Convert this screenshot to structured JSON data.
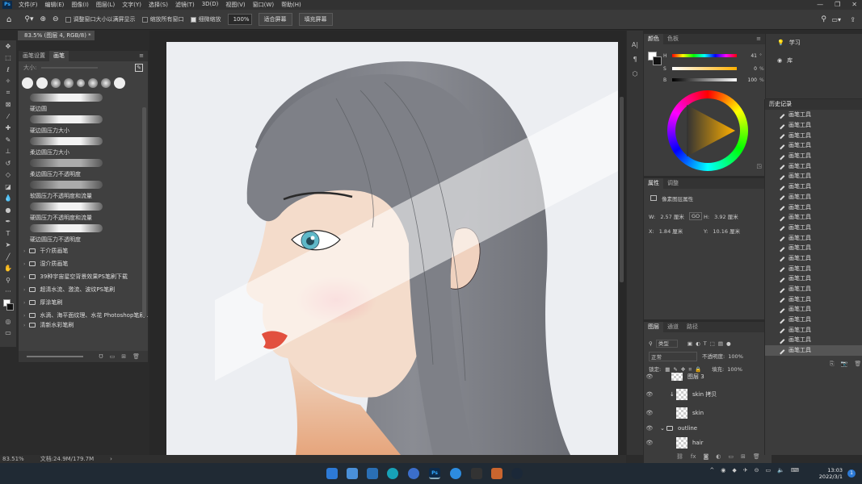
{
  "menu": {
    "app_logo": "Ps",
    "items": [
      "文件(F)",
      "编辑(E)",
      "图像(I)",
      "图层(L)",
      "文字(Y)",
      "选择(S)",
      "滤镜(T)",
      "3D(D)",
      "视图(V)",
      "窗口(W)",
      "帮助(H)"
    ]
  },
  "options": {
    "resize_windows_label": "调整窗口大小以满屏显示",
    "zoom_all_label": "缩放所有窗口",
    "scrubby_zoom_label": "细微缩放",
    "zoom_value": "100%",
    "fit_screen_label": "适合屏幕",
    "fill_screen_label": "填充屏幕"
  },
  "document": {
    "tab_title": "83.5% (图层 4, RGB/8) *",
    "close": "×"
  },
  "brush_panel": {
    "tabs": [
      "画笔设置",
      "画笔"
    ],
    "size_label": "大小:",
    "brushes": [
      "硬边圆",
      "硬边圆压力大小",
      "柔边圆压力大小",
      "柔边圆压力不透明度",
      "软圆压力不透明度和流量",
      "硬圆压力不透明度和流量",
      "硬边圆压力不透明度"
    ],
    "folders": [
      "干介质画笔",
      "湿介质画笔",
      "39种宇宙星空背景效果PS笔刷下载",
      "超清水流、激流、波纹PS笔刷",
      "厚涂笔刷",
      "水滴、海平面纹理、水花 Photoshop笔刷 ...",
      "清新水彩笔刷"
    ]
  },
  "status": {
    "zoom": "83.51%",
    "doc_size": "文档:24.9M/179.7M"
  },
  "color_panel": {
    "tabs": [
      "颜色",
      "色板"
    ],
    "h_label": "H",
    "h_value": "41",
    "s_label": "S",
    "s_value": "0",
    "s_unit": "%",
    "b_label": "B",
    "b_value": "100",
    "b_unit": "%",
    "degree": "°"
  },
  "properties": {
    "tabs": [
      "属性",
      "调整"
    ],
    "section": "像素图层属性",
    "w_label": "W:",
    "w_value": "2.57 厘米",
    "h_label": "H:",
    "h_value": "3.92 厘米",
    "x_label": "X:",
    "x_value": "1.84 厘米",
    "y_label": "Y:",
    "y_value": "10.16 厘米",
    "link": "GO"
  },
  "layers": {
    "tabs": [
      "图层",
      "通道",
      "路径"
    ],
    "filter_label": "类型",
    "blend_mode": "正常",
    "opacity_label": "不透明度:",
    "opacity_value": "100%",
    "lock_label": "锁定:",
    "fill_label": "填充:",
    "fill_value": "100%",
    "rows": [
      "图层 3",
      "skin 拷贝",
      "skin",
      "outline",
      "hair"
    ]
  },
  "dock": {
    "learn": "学习",
    "libraries": "库"
  },
  "history": {
    "title": "历史记录",
    "items": [
      "画笔工具",
      "画笔工具",
      "画笔工具",
      "画笔工具",
      "画笔工具",
      "画笔工具",
      "画笔工具",
      "画笔工具",
      "画笔工具",
      "画笔工具",
      "画笔工具",
      "画笔工具",
      "画笔工具",
      "画笔工具",
      "画笔工具",
      "画笔工具",
      "画笔工具",
      "画笔工具",
      "画笔工具",
      "画笔工具",
      "画笔工具",
      "画笔工具",
      "画笔工具",
      "画笔工具"
    ]
  },
  "taskbar": {
    "time": "13:03",
    "date": "2022/3/1",
    "ps_label": "Ps",
    "notify": "1"
  },
  "colors": {
    "ps_blue": "#31a8ff",
    "panel_bg": "#3c3c3c",
    "hair": "#7b7d83",
    "skin": "#f2d9c8",
    "lips": "#e2503f",
    "iris": "#5fb8c8"
  }
}
